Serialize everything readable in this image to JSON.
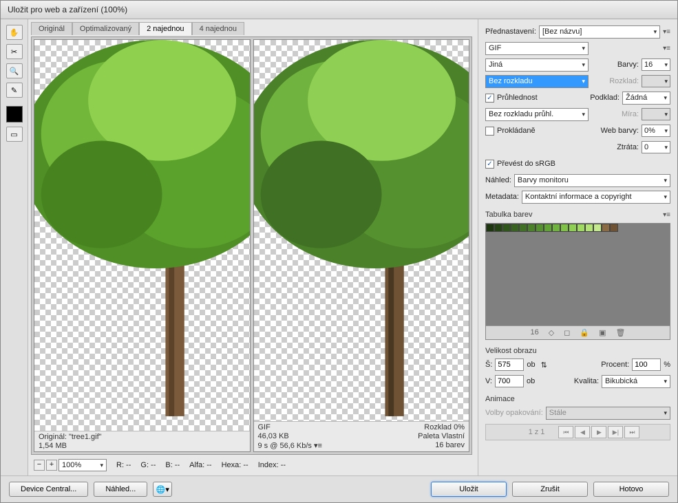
{
  "title": "Uložit pro web a zařízení (100%)",
  "tabs": [
    "Originál",
    "Optimalizovaný",
    "2 najednou",
    "4 najednou"
  ],
  "activeTab": 2,
  "preview1": {
    "line1a": "Originál: \"tree1.gif\"",
    "line1b": "1,54 MB"
  },
  "preview2": {
    "line1a": "GIF",
    "line1b": "46,03 KB",
    "line1c": "9 s @ 56,6 Kb/s  ▾≡",
    "r1": "Rozklad 0%",
    "r2": "Paleta Vlastní",
    "r3": "16 barev"
  },
  "zoom": "100%",
  "readouts": {
    "r": "R: --",
    "g": "G: --",
    "b": "B: --",
    "alfa": "Alfa: --",
    "hexa": "Hexa: --",
    "index": "Index: --"
  },
  "panel": {
    "presetLbl": "Přednastavení:",
    "preset": "[Bez názvu]",
    "format": "GIF",
    "palette": "Jiná",
    "colorsLbl": "Barvy:",
    "colors": "16",
    "dither": "Bez rozkladu",
    "ditherpctLbl": "Rozklad:",
    "ditherpct": "",
    "transparency": "Průhlednost",
    "matteLbl": "Podklad:",
    "matte": "Žádná",
    "transDither": "Bez rozkladu průhl.",
    "amountLbl": "Míra:",
    "amount": "",
    "interlaced": "Prokládaně",
    "webSnapLbl": "Web barvy:",
    "webSnap": "0%",
    "lossyLbl": "Ztráta:",
    "lossy": "0",
    "srgb": "Převést do sRGB",
    "previewLbl": "Náhled:",
    "preview": "Barvy monitoru",
    "metaLbl": "Metadata:",
    "meta": "Kontaktní informace a copyright",
    "colorTable": "Tabulka barev",
    "swatchCount": "16",
    "imageSize": "Velikost obrazu",
    "wLbl": "Š:",
    "w": "575",
    "px1": "ob",
    "hLbl": "V:",
    "h": "700",
    "px2": "ob",
    "pctLbl": "Procent:",
    "pct": "100",
    "pctUnit": "%",
    "qualLbl": "Kvalita:",
    "qual": "Bikubická",
    "anim": "Animace",
    "loopLbl": "Volby opakování:",
    "loop": "Stále",
    "frame": "1 z 1"
  },
  "swatches": [
    "#1d3610",
    "#244414",
    "#2e551a",
    "#37621f",
    "#3f7023",
    "#4a8129",
    "#55922f",
    "#62a336",
    "#70b33e",
    "#7fc247",
    "#8fcf53",
    "#a1da63",
    "#b3e277",
    "#c4e98e",
    "#8a6b43",
    "#6e5233"
  ],
  "buttons": {
    "device": "Device Central...",
    "preview": "Náhled...",
    "save": "Uložit",
    "cancel": "Zrušit",
    "done": "Hotovo"
  }
}
